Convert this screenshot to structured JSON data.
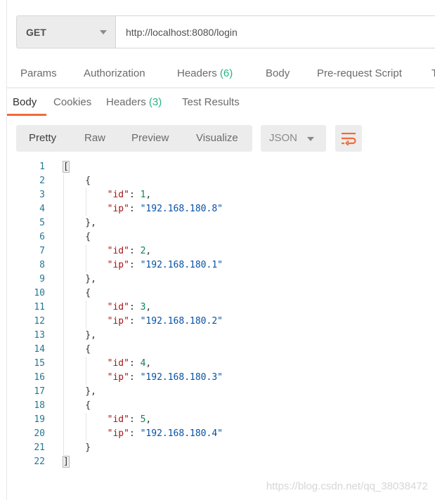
{
  "request": {
    "method": "GET",
    "url": "http://localhost:8080/login"
  },
  "request_tabs": [
    {
      "label": "Params"
    },
    {
      "label": "Authorization"
    },
    {
      "label": "Headers",
      "count": "(6)"
    },
    {
      "label": "Body"
    },
    {
      "label": "Pre-request Script"
    },
    {
      "label": "T"
    }
  ],
  "response_tabs": [
    {
      "label": "Body",
      "active": true
    },
    {
      "label": "Cookies"
    },
    {
      "label": "Headers",
      "count": "(3)"
    },
    {
      "label": "Test Results"
    }
  ],
  "view_modes": [
    {
      "label": "Pretty",
      "active": true
    },
    {
      "label": "Raw"
    },
    {
      "label": "Preview"
    },
    {
      "label": "Visualize"
    }
  ],
  "format": "JSON",
  "wrap_icon": "wrap-lines-icon",
  "colors": {
    "accent": "#f26b3a",
    "count": "#26b47f",
    "json_key": "#a31515",
    "json_number": "#098658",
    "json_string": "#0451a5",
    "line_number": "#237893"
  },
  "response_body": [
    {
      "id": 1,
      "ip": "192.168.180.8"
    },
    {
      "id": 2,
      "ip": "192.168.180.1"
    },
    {
      "id": 3,
      "ip": "192.168.180.2"
    },
    {
      "id": 4,
      "ip": "192.168.180.3"
    },
    {
      "id": 5,
      "ip": "192.168.180.4"
    }
  ],
  "watermark": "https://blog.csdn.net/qq_38038472"
}
